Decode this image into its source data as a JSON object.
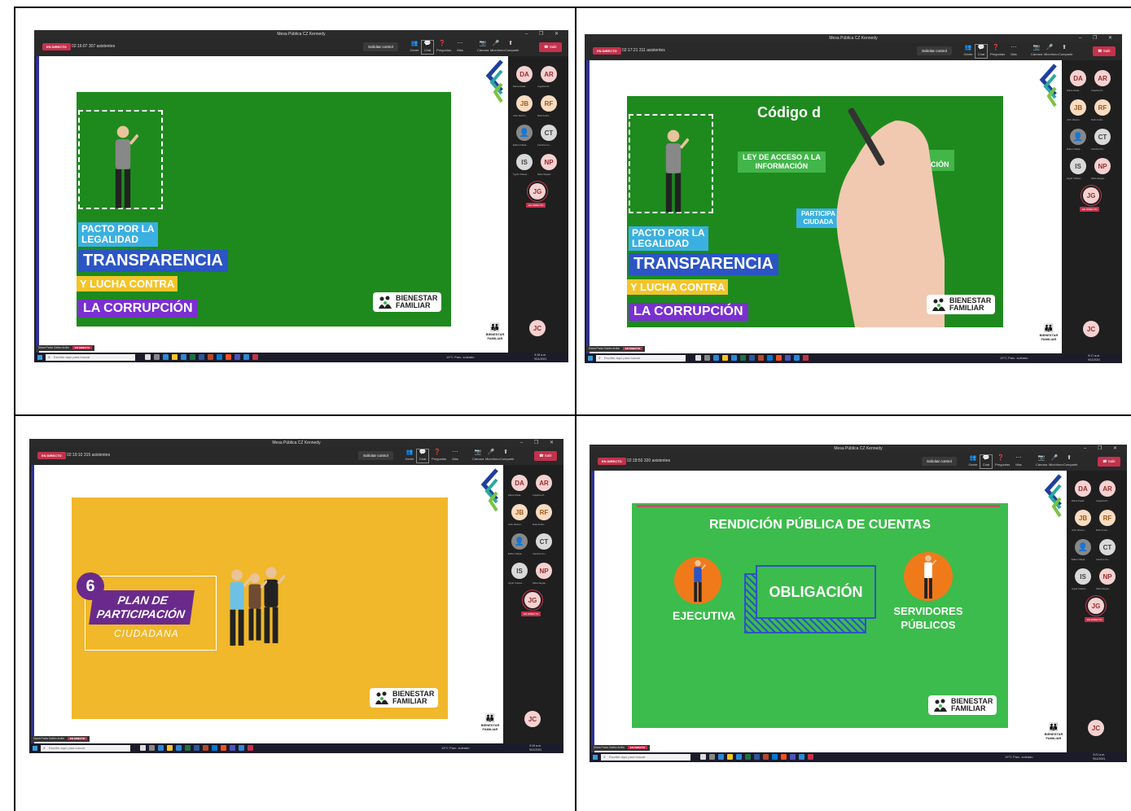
{
  "common": {
    "live_badge": "EN DIRECTO",
    "control_btn": "Solicitar control",
    "icons": [
      "Gente",
      "Chat",
      "Preguntas y...",
      "Más",
      "Cámara",
      "Micrófono",
      "Compartir"
    ],
    "leave_btn": "Salir",
    "tooltip": "Mostrar conversación",
    "search_placeholder": "Escribe aquí para buscar",
    "speaker_name": "Diana Paola Gaitán Ardila",
    "speaker_live": "EN DIRECTO",
    "panel_live": "EN DIRECTO",
    "weather": "19°C Parc. soleado",
    "participants": [
      {
        "initials": "DA",
        "name": "Diana Paola..."
      },
      {
        "initials": "AR",
        "name": "Angelica M..."
      },
      {
        "initials": "JB",
        "name": "John Alberto..."
      },
      {
        "initials": "RF",
        "name": "Ruth Andre..."
      },
      {
        "initials": "",
        "name": "Edison Mejía..."
      },
      {
        "initials": "CT",
        "name": "Carolina Cu..."
      },
      {
        "initials": "IS",
        "name": "Ingrid Yuliana..."
      },
      {
        "initials": "NP",
        "name": "Nidia Vargas..."
      },
      {
        "initials": "JG",
        "name": ""
      }
    ],
    "self_initials": "JC",
    "bf_logo_line1": "BIENESTAR",
    "bf_logo_line2": "FAMILIAR"
  },
  "shots": [
    {
      "title": "Mesa Pública CZ Kennedy",
      "timer": "02:16:07",
      "attendees": "307 asistentes",
      "clock_time": "9:16 a.m.",
      "clock_date": "9/11/2021",
      "slide": {
        "pacto": [
          "PACTO POR LA",
          "LEGALIDAD"
        ],
        "transparencia": "TRANSPARENCIA",
        "lucha": "Y LUCHA CONTRA",
        "corrupcion": "LA CORRUPCIÓN"
      }
    },
    {
      "title": "Mesa Pública CZ Kennedy",
      "timer": "02:17:21",
      "attendees": "311 asistentes",
      "clock_time": "9:17 a.m.",
      "clock_date": "9/11/2021",
      "slide": {
        "codigo": "Código d",
        "ley": [
          "LEY DE ACCESO A LA",
          "INFORMACIÓN"
        ],
        "plan": [
          "PLAN",
          "CORRUPCIÓN"
        ],
        "particip": [
          "PARTICIPA",
          "CIUDADA"
        ],
        "pacto": [
          "PACTO POR LA",
          "LEGALIDAD"
        ],
        "transparencia": "TRANSPARENCIA",
        "lucha": "Y LUCHA CONTRA",
        "corrupcion": "LA CORRUPCIÓN"
      }
    },
    {
      "title": "Mesa Pública CZ Kennedy",
      "timer": "02:19:10",
      "attendees": "315 asistentes",
      "clock_time": "9:19 a.m.",
      "clock_date": "9/11/2021",
      "slide": {
        "number": "6",
        "line1": "PLAN DE",
        "line2": "PARTICIPACIÓN",
        "line3": "CIUDADANA"
      }
    },
    {
      "title": "Mesa Pública CZ Kennedy",
      "timer": "02:18:50",
      "attendees": "320 asistentes",
      "clock_time": "9:21 a.m.",
      "clock_date": "9/11/2021",
      "slide": {
        "heading": "RENDICIÓN PÚBLICA DE CUENTAS",
        "center": "OBLIGACIÓN",
        "left": "EJECUTIVA",
        "right": [
          "SERVIDORES",
          "PÚBLICOS"
        ]
      }
    }
  ]
}
